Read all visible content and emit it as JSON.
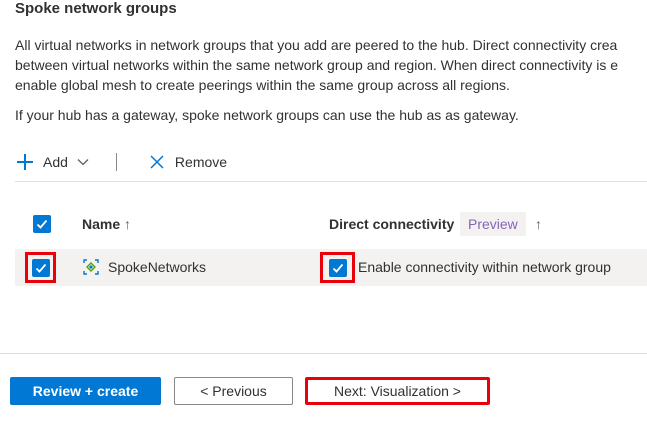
{
  "section": {
    "title": "Spoke network groups",
    "description_lines": [
      "All virtual networks in network groups that you add are peered to the hub. Direct connectivity crea",
      "between virtual networks within the same network group and region. When direct connectivity is e",
      "enable global mesh to create peerings within the same group across all regions."
    ],
    "note": "If your hub has a gateway, spoke network groups can use the hub as as gateway."
  },
  "toolbar": {
    "add_label": "Add",
    "remove_label": "Remove"
  },
  "grid": {
    "columns": {
      "name": "Name",
      "name_sort": "↑",
      "direct_connectivity": "Direct connectivity",
      "preview_badge": "Preview",
      "dc_sort": "↑"
    },
    "header_checkbox_checked": true,
    "rows": [
      {
        "checked": true,
        "name": "SpokeNetworks",
        "connectivity_checked": true,
        "connectivity_label": "Enable connectivity within network group"
      }
    ]
  },
  "footer": {
    "review_create_label": "Review + create",
    "previous_label": "< Previous",
    "next_label": "Next: Visualization >"
  },
  "colors": {
    "accent": "#0078d4",
    "highlight": "#e8000b",
    "preview": "#8764b8"
  }
}
